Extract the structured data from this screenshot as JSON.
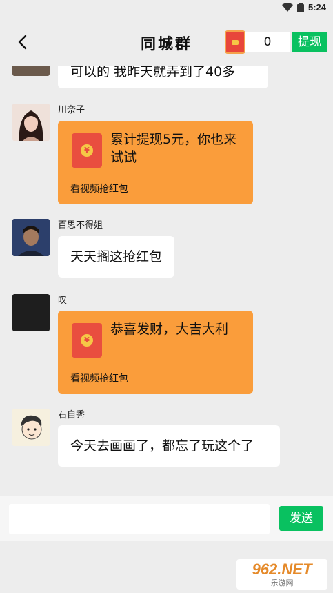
{
  "status": {
    "time": "5:24",
    "icons": [
      "wifi-icon",
      "battery-icon"
    ]
  },
  "header": {
    "title": "同城群",
    "back_icon": "back-arrow-icon",
    "balance": "0",
    "withdraw_label": "提现",
    "coin_icon": "red-packet-icon"
  },
  "messages": [
    {
      "type": "text",
      "name": "",
      "text": "可以的 我昨天就弄到了40多"
    },
    {
      "type": "redpacket",
      "name": "川奈子",
      "text": "累计提现5元，你也来试试",
      "footer": "看视频抢红包"
    },
    {
      "type": "text",
      "name": "百思不得姐",
      "text": "天天搁这抢红包"
    },
    {
      "type": "redpacket",
      "name": "叹",
      "text": "恭喜发财，大吉大利",
      "footer": "看视频抢红包"
    },
    {
      "type": "text",
      "name": "石自秀",
      "text": "今天去画画了，都忘了玩这个了"
    }
  ],
  "input": {
    "value": "",
    "send_label": "发送"
  },
  "watermark": {
    "logo": "962.NET",
    "sub": "乐游网"
  },
  "colors": {
    "green": "#09c160",
    "orange": "#fa9d3b",
    "red": "#e94e3f",
    "background": "#ededed"
  }
}
